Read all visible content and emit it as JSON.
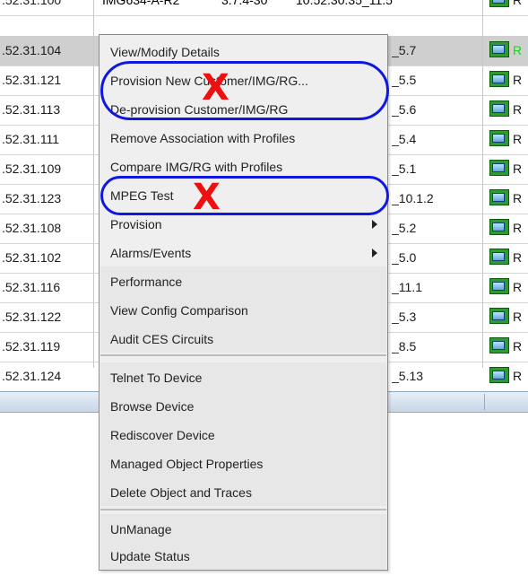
{
  "table": {
    "top_row": {
      "ip": ".52.31.100",
      "model": "IMG634-A-R2",
      "version_a": "3.7.4-30",
      "version_b": "10.52.30.35_11.5",
      "status_letter": "R"
    },
    "rows": [
      {
        "ip": ".52.31.104",
        "version": "_5.7",
        "status_letter": "R"
      },
      {
        "ip": ".52.31.121",
        "version": "_5.5",
        "status_letter": "R"
      },
      {
        "ip": ".52.31.113",
        "version": "_5.6",
        "status_letter": "R"
      },
      {
        "ip": ".52.31.111",
        "version": "_5.4",
        "status_letter": "R"
      },
      {
        "ip": ".52.31.109",
        "version": "_5.1",
        "status_letter": "R"
      },
      {
        "ip": ".52.31.123",
        "version": "_10.1.2",
        "status_letter": "R"
      },
      {
        "ip": ".52.31.108",
        "version": "_5.2",
        "status_letter": "R"
      },
      {
        "ip": ".52.31.102",
        "version": "_5.0",
        "status_letter": "R"
      },
      {
        "ip": ".52.31.116",
        "version": "_11.1",
        "status_letter": "R"
      },
      {
        "ip": ".52.31.122",
        "version": "_5.3",
        "status_letter": "R"
      },
      {
        "ip": ".52.31.119",
        "version": "_8.5",
        "status_letter": "R"
      },
      {
        "ip": ".52.31.124",
        "version": "_5.13",
        "status_letter": "R"
      }
    ]
  },
  "menu": {
    "items": [
      {
        "label": "View/Modify Details"
      },
      {
        "label": "Provision New Customer/IMG/RG..."
      },
      {
        "label": "De-provision Customer/IMG/RG"
      },
      {
        "label": "Remove Association with Profiles"
      },
      {
        "label": "Compare IMG/RG with Profiles"
      },
      {
        "label": "MPEG Test"
      },
      {
        "label": "Provision",
        "has_submenu": true
      },
      {
        "label": "Alarms/Events",
        "has_submenu": true
      },
      {
        "label": "Performance"
      },
      {
        "label": "View Config Comparison"
      },
      {
        "label": "Audit CES Circuits"
      },
      {
        "label": "Telnet To Device"
      },
      {
        "label": "Browse Device"
      },
      {
        "label": "Rediscover Device"
      },
      {
        "label": "Managed Object Properties"
      },
      {
        "label": "Delete Object and Traces"
      },
      {
        "label": "UnManage"
      },
      {
        "label": "Update Status"
      }
    ]
  },
  "annotations": {
    "mark": "X"
  },
  "colors": {
    "annotation_oval": "#1018e0",
    "annotation_x": "#ee1010",
    "status_icon": "#2f9a2f",
    "selected_row": "#cfcfcf",
    "menu_background": "#efefef"
  },
  "icons": {
    "status": "device-status-icon",
    "submenu": "submenu-arrow-icon"
  }
}
